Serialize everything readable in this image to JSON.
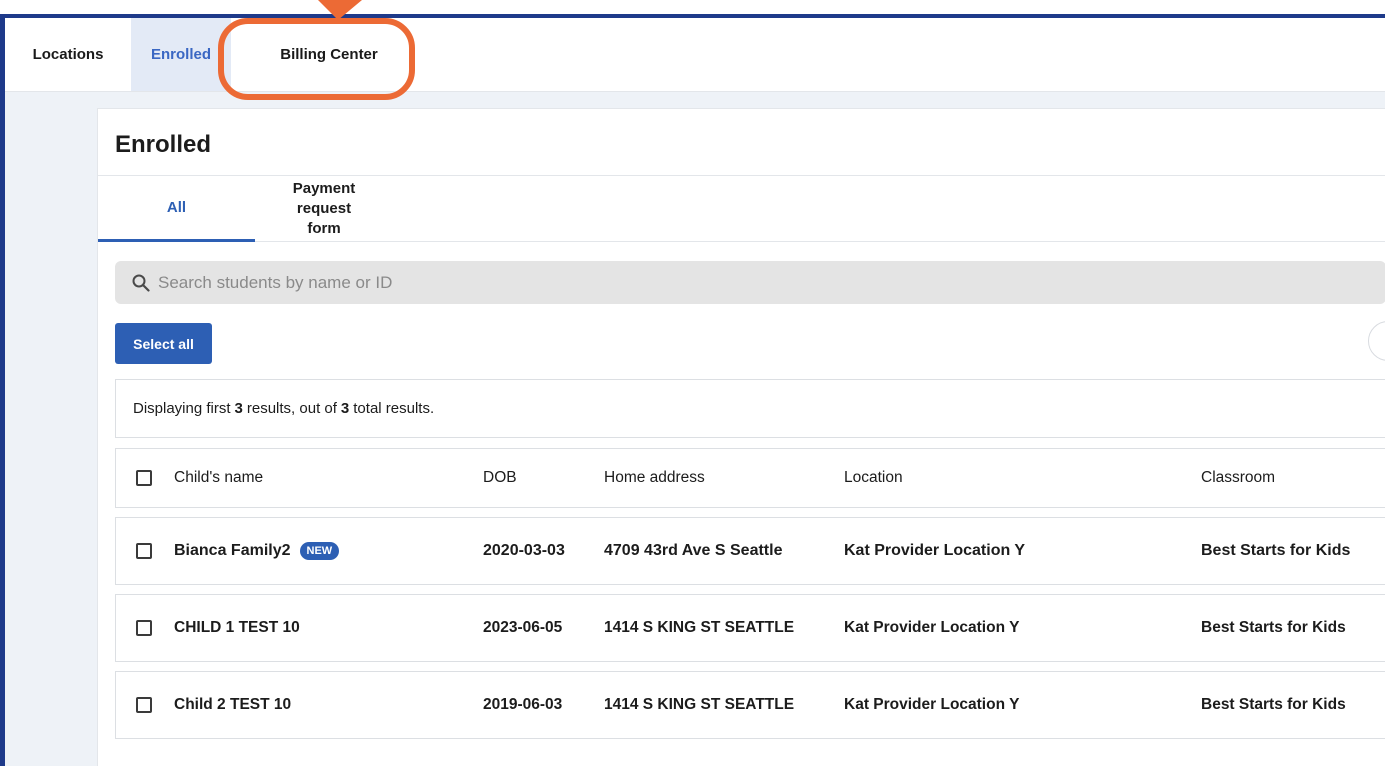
{
  "topnav": {
    "tabs": [
      {
        "label": "Locations"
      },
      {
        "label": "Enrolled"
      },
      {
        "label": "Billing Center"
      }
    ]
  },
  "page": {
    "title": "Enrolled",
    "subtabs": [
      {
        "label": "All"
      },
      {
        "label": "Payment request form"
      }
    ],
    "search": {
      "placeholder": "Search students by name or ID"
    },
    "select_all_label": "Select all",
    "results": {
      "prefix": "Displaying first",
      "shown": "3",
      "middle": "results, out of",
      "total": "3",
      "suffix": "total results."
    }
  },
  "table": {
    "headers": {
      "name": "Child's name",
      "dob": "DOB",
      "address": "Home address",
      "location": "Location",
      "classroom": "Classroom"
    },
    "rows": [
      {
        "name": "Bianca Family2",
        "badge": "NEW",
        "dob": "2020-03-03",
        "address": "4709 43rd Ave S Seattle",
        "location": "Kat Provider Location Y",
        "classroom": "Best Starts for Kids"
      },
      {
        "name": "CHILD 1 TEST 10",
        "dob": "2023-06-05",
        "address": "1414 S KING ST SEATTLE",
        "location": "Kat Provider Location Y",
        "classroom": "Best Starts for Kids"
      },
      {
        "name": "Child 2 TEST 10",
        "dob": "2019-06-03",
        "address": "1414 S KING ST SEATTLE",
        "location": "Kat Provider Location Y",
        "classroom": "Best Starts for Kids"
      }
    ]
  },
  "colors": {
    "accent": "#2d5fb4",
    "frame": "#1e3a8a",
    "annotation": "#ec6a35"
  }
}
